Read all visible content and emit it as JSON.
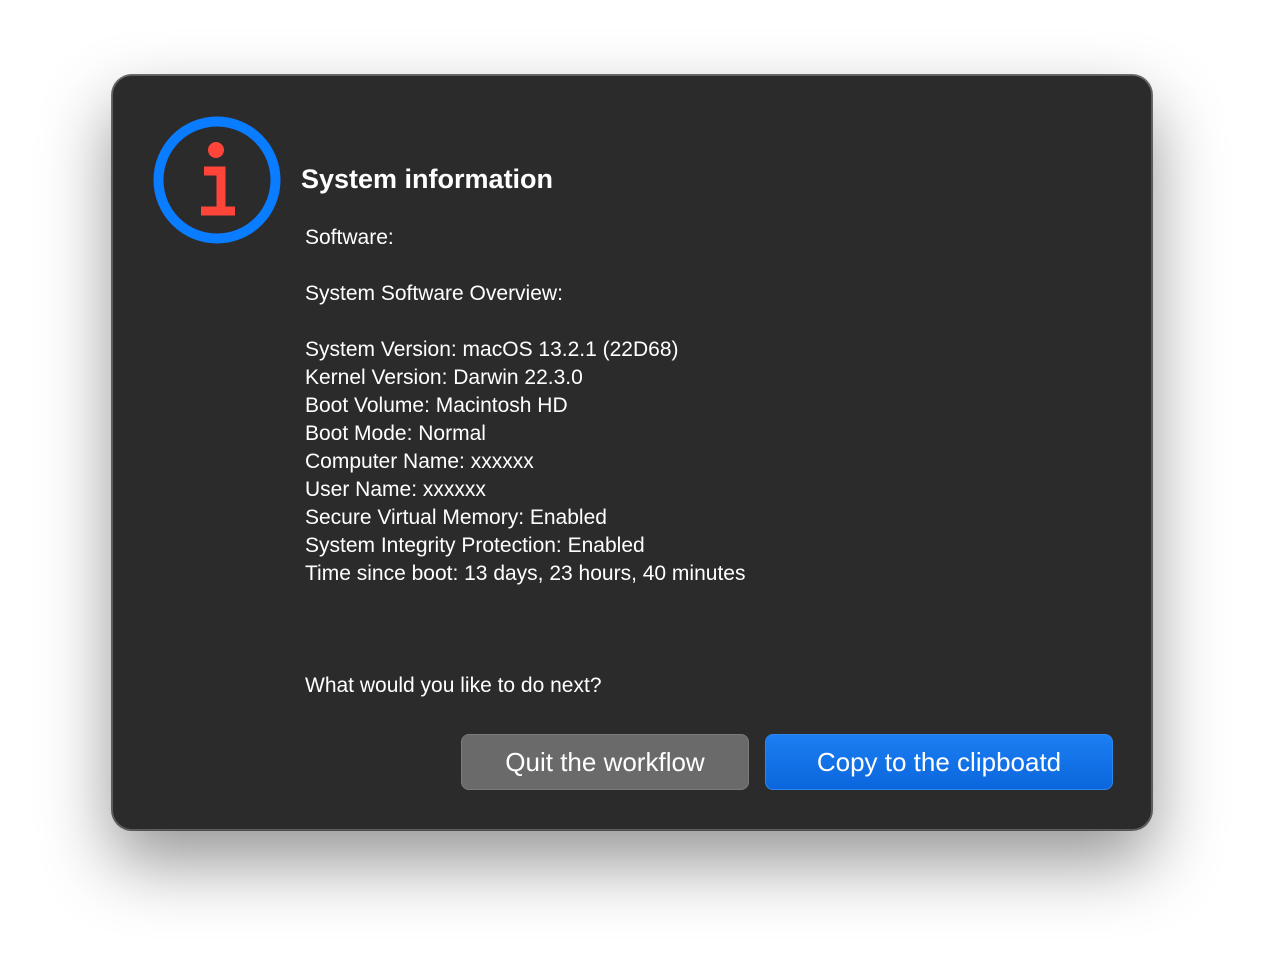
{
  "dialog": {
    "title": "System information",
    "lines": [
      "Software:",
      "",
      "System Software Overview:",
      "",
      "System Version: macOS 13.2.1 (22D68)",
      "Kernel Version: Darwin 22.3.0",
      "Boot Volume: Macintosh HD",
      "Boot Mode: Normal",
      "Computer Name: xxxxxx",
      "User Name: xxxxxx",
      "Secure Virtual Memory: Enabled",
      "System Integrity Protection: Enabled",
      "Time since boot: 13 days, 23 hours, 40 minutes"
    ],
    "question": "What would you like to do next?",
    "buttons": {
      "quit_label": "Quit the workflow",
      "copy_label": "Copy to the clipboatd"
    },
    "icon": "info-icon"
  },
  "colors": {
    "dialog_background": "#2b2b2c",
    "icon_ring": "#0a7cff",
    "icon_glyph": "#ff453a",
    "primary_button": "#0b6fe6",
    "secondary_button": "#6a6a6b",
    "text": "#ffffff"
  }
}
